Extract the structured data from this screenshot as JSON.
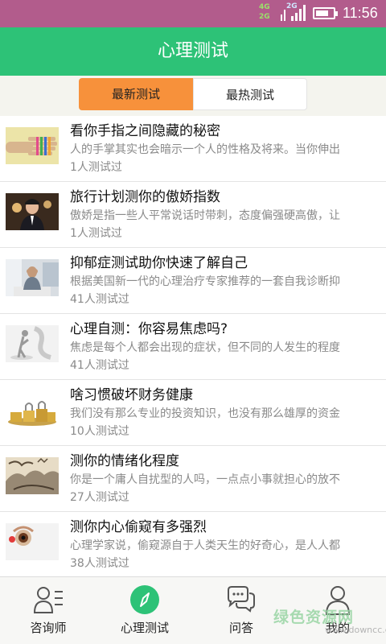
{
  "status_bar": {
    "network_4g": "4G",
    "network_2g_a": "2G",
    "network_2g_b": "2G",
    "battery_level": 0.75,
    "time": "11:56"
  },
  "header": {
    "title": "心理测试"
  },
  "tabs": [
    {
      "label": "最新测试",
      "active": true
    },
    {
      "label": "最热测试",
      "active": false
    }
  ],
  "tests": [
    {
      "title": "看你手指之间隐藏的秘密",
      "desc": "人的手掌其实也会暗示一个人的性格及将来。当你伸出",
      "count": "1人测试过",
      "thumb": "fingers-image"
    },
    {
      "title": "旅行计划测你的傲娇指数",
      "desc": "傲娇是指一些人平常说话时带刺，态度偏强硬高傲，让",
      "count": "1人测试过",
      "thumb": "man-portrait-image"
    },
    {
      "title": "抑郁症测试助你快速了解自己",
      "desc": "根据美国新一代的心理治疗专家推荐的一套自我诊断抑",
      "count": "41人测试过",
      "thumb": "sad-person-image"
    },
    {
      "title": "心理自测：你容易焦虑吗?",
      "desc": "焦虑是每个人都会出现的症状，但不同的人发生的程度",
      "count": "41人测试过",
      "thumb": "anxious-figure-image"
    },
    {
      "title": "啥习惯破坏财务健康",
      "desc": "我们没有那么专业的投资知识，也没有那么雄厚的资金",
      "count": "10人测试过",
      "thumb": "locked-coins-image"
    },
    {
      "title": "测你的情绪化程度",
      "desc": "你是一个庸人自扰型的人吗，一点点小事就担心的放不",
      "count": "27人测试过",
      "thumb": "ink-painting-image"
    },
    {
      "title": "测你内心偷窥有多强烈",
      "desc": "心理学家说，偷窥源自于人类天生的好奇心，是人人都",
      "count": "38人测试过",
      "thumb": "peeping-eye-image"
    }
  ],
  "bottom_nav": [
    {
      "label": "咨询师",
      "icon": "counselor-icon",
      "active": false
    },
    {
      "label": "心理测试",
      "icon": "compass-icon",
      "active": true
    },
    {
      "label": "问答",
      "icon": "chat-bubbles-icon",
      "active": false
    },
    {
      "label": "我的",
      "icon": "profile-icon",
      "active": false
    }
  ],
  "colors": {
    "status_bar": "#b25c8c",
    "header": "#2dc277",
    "active_tab": "#f7913b",
    "accent": "#2dc277"
  },
  "watermark": {
    "text": "绿色资源网",
    "url": "www.downcc.com"
  }
}
